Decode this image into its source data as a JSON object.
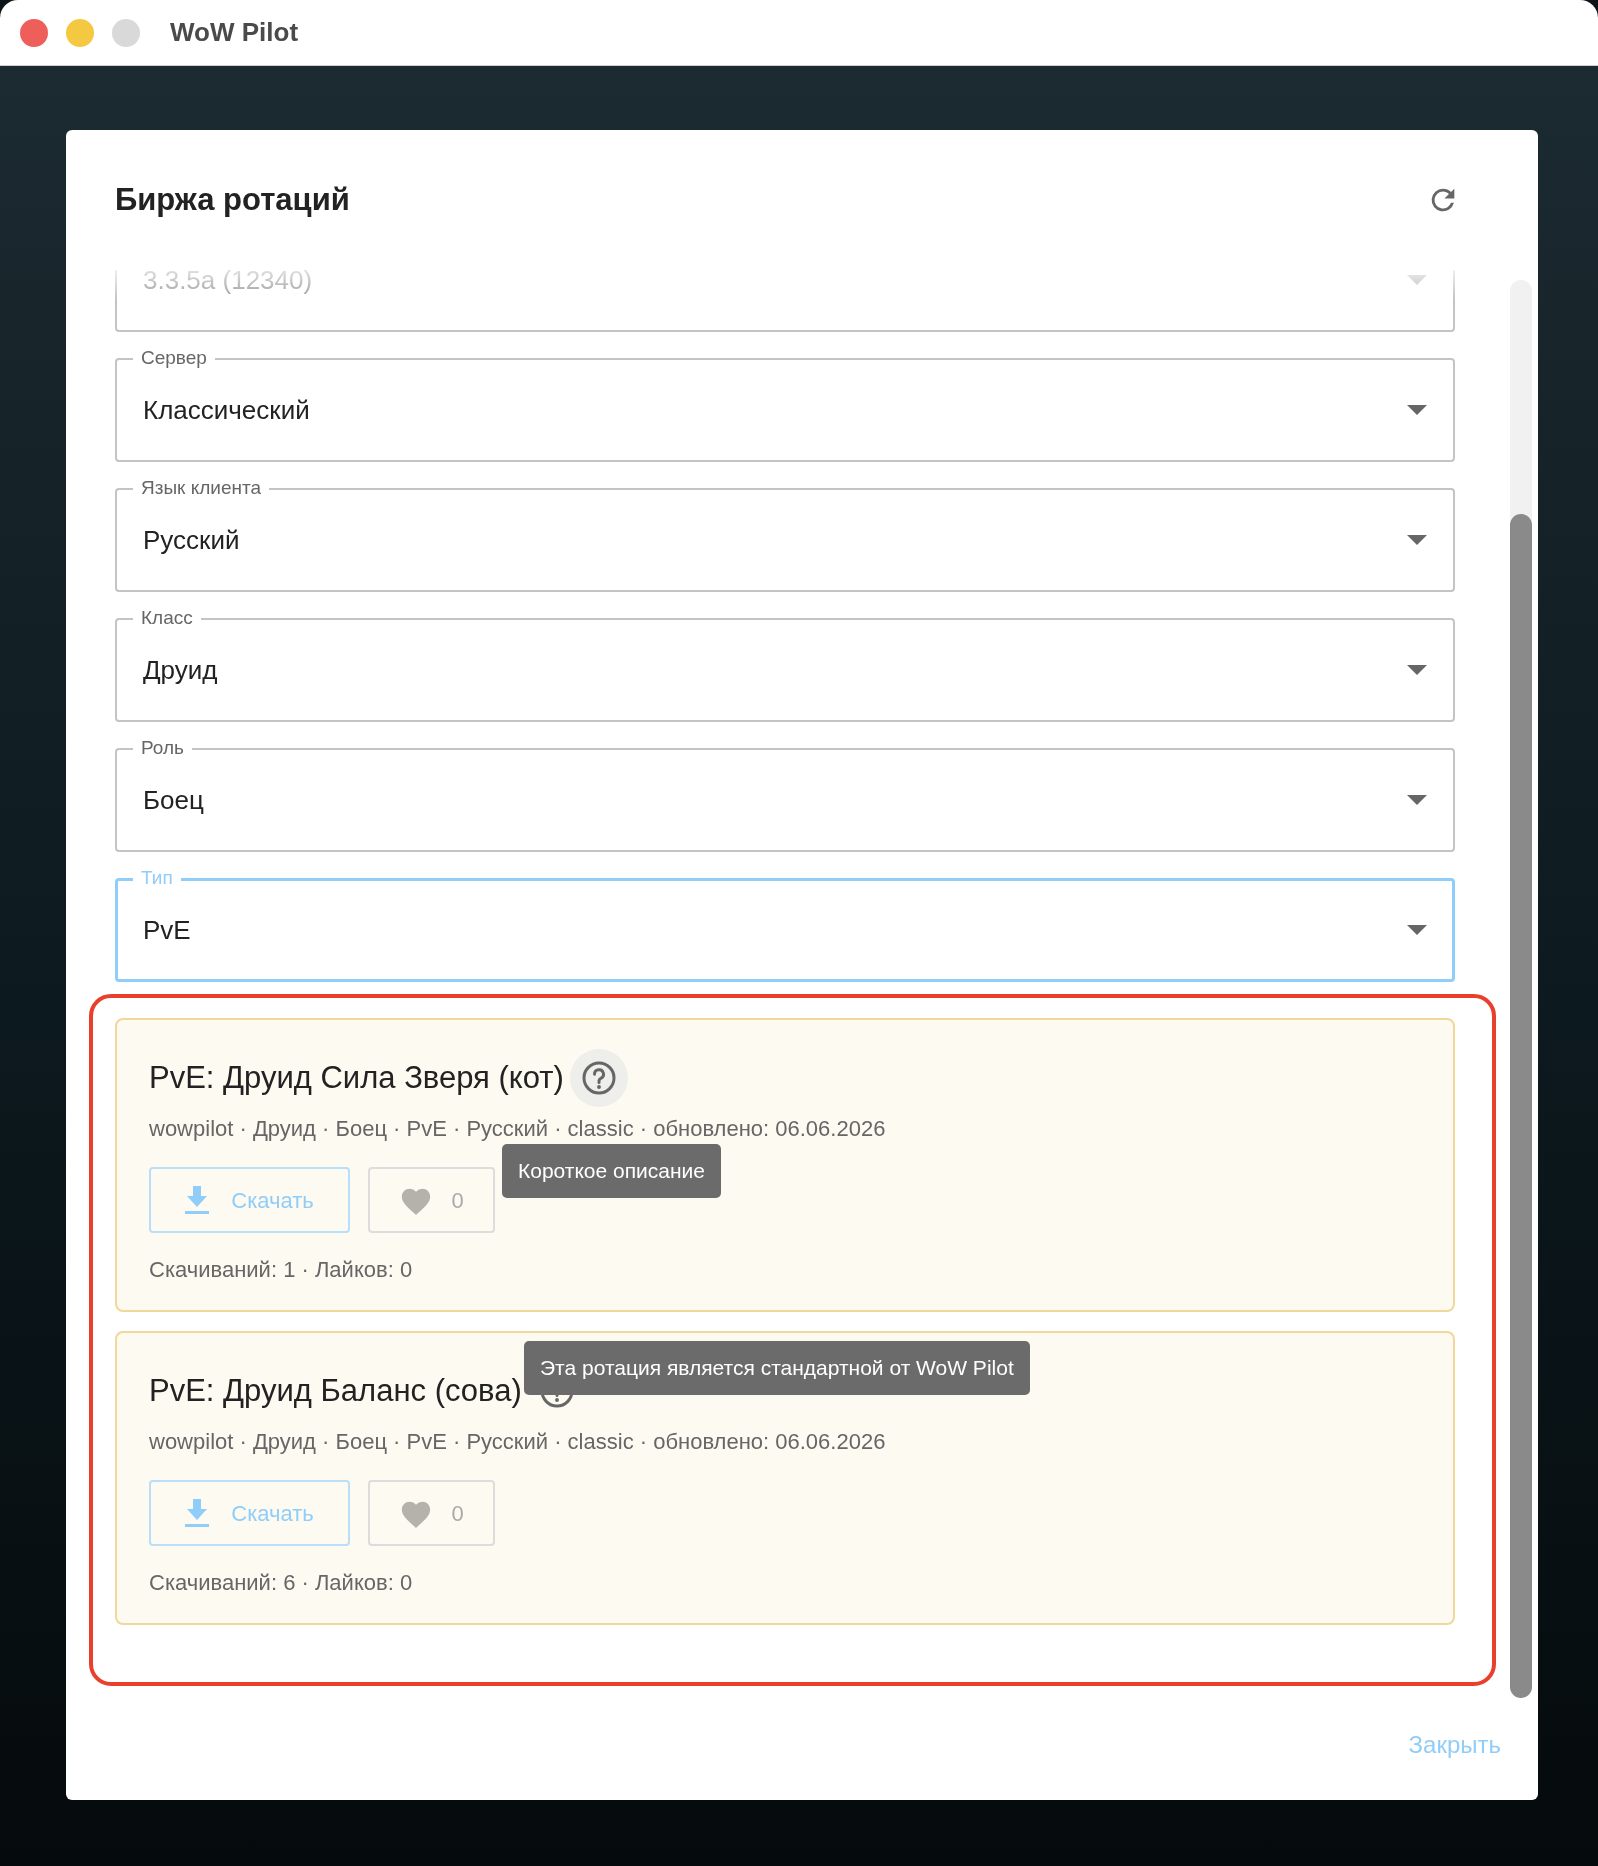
{
  "window": {
    "title": "WoW Pilot"
  },
  "dialog": {
    "title": "Биржа ротаций",
    "fields": [
      {
        "value": "3.3.5a (12340)",
        "disabled": true,
        "focused": false
      },
      {
        "label": "Сервер",
        "value": "Классический",
        "disabled": false,
        "focused": false
      },
      {
        "label": "Язык клиента",
        "value": "Русский",
        "disabled": false,
        "focused": false
      },
      {
        "label": "Класс",
        "value": "Друид",
        "disabled": false,
        "focused": false
      },
      {
        "label": "Роль",
        "value": "Боец",
        "disabled": false,
        "focused": false
      },
      {
        "label": "Тип",
        "value": "PvE",
        "disabled": false,
        "focused": true
      }
    ],
    "rotations": [
      {
        "title": "PvE: Друид Сила Зверя (кот)",
        "help_hovered": true,
        "meta": "wowpilot · Друид · Боец · PvE · Русский · classic · обновлено: 06.06.2026",
        "download": "Скачать",
        "likes": "0",
        "stats": "Скачиваний: 1 · Лайков: 0",
        "tooltip": "Короткое описание"
      },
      {
        "title": "PvE: Друид Баланс (сова)",
        "help_hovered": false,
        "meta": "wowpilot · Друид · Боец · PvE · Русский · classic · обновлено: 06.06.2026",
        "download": "Скачать",
        "likes": "0",
        "stats": "Скачиваний: 6 · Лайков: 0",
        "tooltip": "Эта ротация является стандартной от WoW Pilot"
      }
    ],
    "close": "Закрыть"
  }
}
